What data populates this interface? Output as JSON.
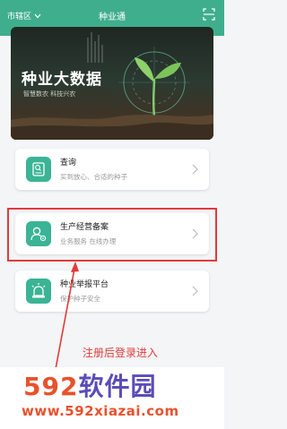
{
  "header": {
    "district": "市辖区",
    "title": "种业通"
  },
  "hero": {
    "title": "种业大数据",
    "subtitle": "智慧数农 科技兴农"
  },
  "cards": [
    {
      "name": "查询",
      "desc": "买到放心、合适的种子"
    },
    {
      "name": "生产经营备案",
      "desc": "业务服务 在线办理"
    },
    {
      "name": "种业举报平台",
      "desc": "保护种子安全"
    }
  ],
  "annotation": "注册后登录进入",
  "watermark": {
    "brand_num": "592",
    "brand_text": "软件园",
    "url": "www.592xiazai.com"
  },
  "colors": {
    "accent": "#3fae8c",
    "highlight": "#e23a3a"
  }
}
